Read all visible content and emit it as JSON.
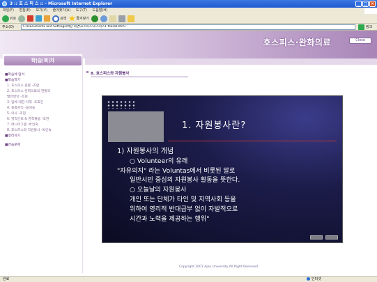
{
  "window": {
    "title": "3 :: 호 스 피 스 :: - Microsoft Internet Explorer",
    "menu": [
      "파일(F)",
      "편집(E)",
      "보기(V)",
      "즐겨찾기(A)",
      "도구(T)",
      "도움말(H)"
    ],
    "controls": [
      "_",
      "□",
      "×"
    ]
  },
  "toolbar": {
    "back_label": "뒤로",
    "search_label": "검색",
    "favorites_label": "즐겨찾기"
  },
  "address": {
    "label": "주소(D)",
    "url": "C:\\Documents and Settings\\바탕 화면\\호스피스\\호스피스1.files\\8.html",
    "links_label": "링크"
  },
  "page": {
    "header_title": "호스피스·완화의료",
    "close_label": "Close",
    "sidebar_title": "학|습|목|차",
    "sidebar_items": [
      {
        "label": "■학습에 앞서",
        "kind": "head"
      },
      {
        "label": "■학습하기",
        "kind": "head"
      },
      {
        "label": "1. 호스피스 총론 -조현",
        "kind": "sub"
      },
      {
        "label": "2. 호스피스 완화의료의 현황과",
        "kind": "sub"
      },
      {
        "label": "   발전방안 -조현",
        "kind": "sub"
      },
      {
        "label": "3. 암에 대한 이해 -조효진",
        "kind": "sub"
      },
      {
        "label": "4. 통증관리 -용애숙",
        "kind": "sub"
      },
      {
        "label": "5. 의사 -조현",
        "kind": "sub"
      },
      {
        "label": "6. 영적간호 & 영적돌봄 -조현",
        "kind": "sub"
      },
      {
        "label": "7. 애니어그램 -박인숙",
        "kind": "sub"
      },
      {
        "label": "8. 호스피스와 자원봉사 -박인숙",
        "kind": "sub"
      },
      {
        "label": "■정리하기",
        "kind": "head"
      },
      {
        "label": "■연습문제",
        "kind": "head gap"
      }
    ],
    "section_heading": "8. 호스피스와 자원봉사",
    "copyright": "Copyright 2007  Ajou University  All Right Reserved"
  },
  "slide": {
    "title": "1. 자원봉사란?",
    "lines": [
      {
        "text": "1) 자원봉사의 개념",
        "cls": "l1"
      },
      {
        "text": "○ Volunteer의 유래",
        "cls": "ind2"
      },
      {
        "text": "\"자유의지\" 라는 Voluntas에서 비롯된 말로",
        "cls": ""
      },
      {
        "text": "일반시민 중심의 자원봉사 활동을 뜻한다.",
        "cls": "ind"
      },
      {
        "text": "○ 오늘날의 자원봉사",
        "cls": "ind2"
      },
      {
        "text": "개인 또는 단체가 타인 및 지역사회 등을",
        "cls": "ind"
      },
      {
        "text": "위하여 영리적 반대급부 없이 자발적으로",
        "cls": "ind"
      },
      {
        "text": "시간과 노력을 제공하는 행위\"",
        "cls": "ind"
      }
    ]
  },
  "status": {
    "left": "완료",
    "right": "인터넷"
  }
}
